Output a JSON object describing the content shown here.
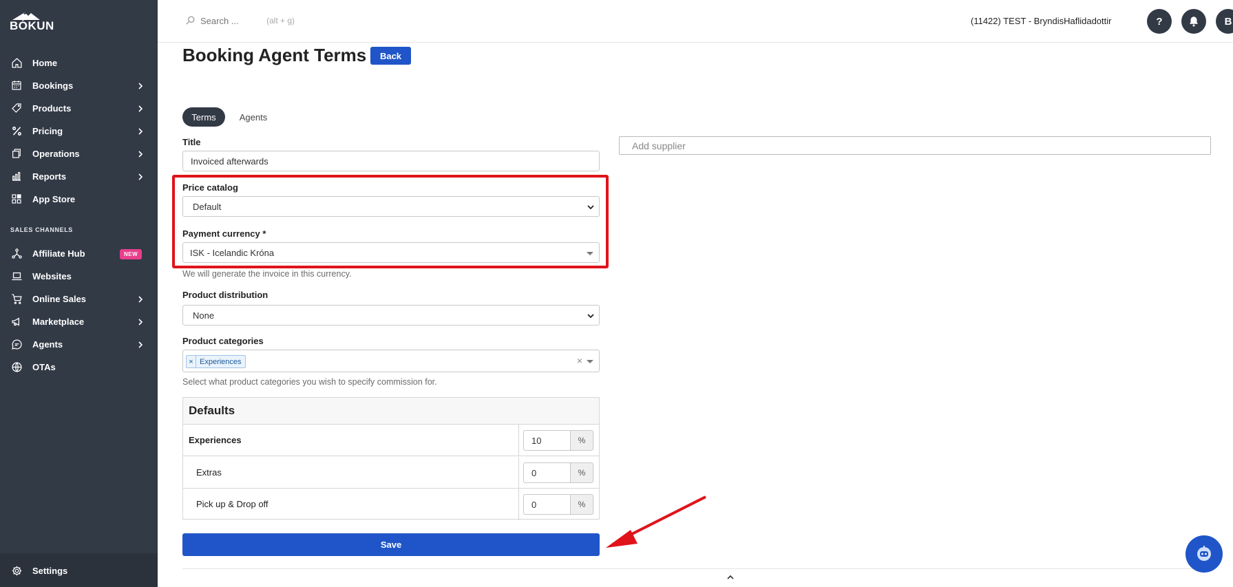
{
  "app": {
    "logo_text": "BÓKUN"
  },
  "sidebar": {
    "items": [
      {
        "label": "Home",
        "icon": "home-icon",
        "chevron": false
      },
      {
        "label": "Bookings",
        "icon": "calendar-icon",
        "chevron": true
      },
      {
        "label": "Products",
        "icon": "tag-icon",
        "chevron": true
      },
      {
        "label": "Pricing",
        "icon": "percent-icon",
        "chevron": true
      },
      {
        "label": "Operations",
        "icon": "copy-icon",
        "chevron": true
      },
      {
        "label": "Reports",
        "icon": "bar-chart-icon",
        "chevron": true
      },
      {
        "label": "App Store",
        "icon": "grid-icon",
        "chevron": false
      }
    ],
    "section_label": "SALES CHANNELS",
    "channel_items": [
      {
        "label": "Affiliate Hub",
        "icon": "network-icon",
        "badge": "NEW",
        "chevron": false
      },
      {
        "label": "Websites",
        "icon": "laptop-icon",
        "chevron": false
      },
      {
        "label": "Online Sales",
        "icon": "cart-icon",
        "chevron": true
      },
      {
        "label": "Marketplace",
        "icon": "megaphone-icon",
        "chevron": true
      },
      {
        "label": "Agents",
        "icon": "chat-icon",
        "chevron": true
      },
      {
        "label": "OTAs",
        "icon": "globe-icon",
        "chevron": false
      }
    ],
    "settings_label": "Settings"
  },
  "topbar": {
    "search_placeholder": "Search ...",
    "search_hint": "(alt + g)",
    "account": "(11422) TEST - BryndisHaflidadottir",
    "help_label": "?",
    "avatar_letter": "B"
  },
  "page": {
    "title": "Booking Agent Terms",
    "back_label": "Back",
    "tabs": [
      "Terms",
      "Agents"
    ],
    "active_tab": "Terms"
  },
  "form": {
    "title_label": "Title",
    "title_value": "Invoiced afterwards",
    "price_catalog_label": "Price catalog",
    "price_catalog_value": "Default",
    "payment_currency_label": "Payment currency *",
    "payment_currency_value": "ISK - Icelandic Króna",
    "currency_help": "We will generate the invoice in this currency.",
    "product_distribution_label": "Product distribution",
    "product_distribution_value": "None",
    "product_categories_label": "Product categories",
    "product_categories_tags": [
      "Experiences"
    ],
    "product_categories_help": "Select what product categories you wish to specify commission for.",
    "supplier_placeholder": "Add supplier",
    "save_label": "Save"
  },
  "defaults_table": {
    "heading": "Defaults",
    "rows": [
      {
        "name": "Experiences",
        "value": "10",
        "unit": "%",
        "bold": true
      },
      {
        "name": "Extras",
        "value": "0",
        "unit": "%",
        "bold": false
      },
      {
        "name": "Pick up & Drop off",
        "value": "0",
        "unit": "%",
        "bold": false
      }
    ]
  },
  "colors": {
    "sidebar_bg": "#323a46",
    "primary": "#1f55c8",
    "highlight": "#e0131a",
    "new_badge": "#e83e8c"
  }
}
